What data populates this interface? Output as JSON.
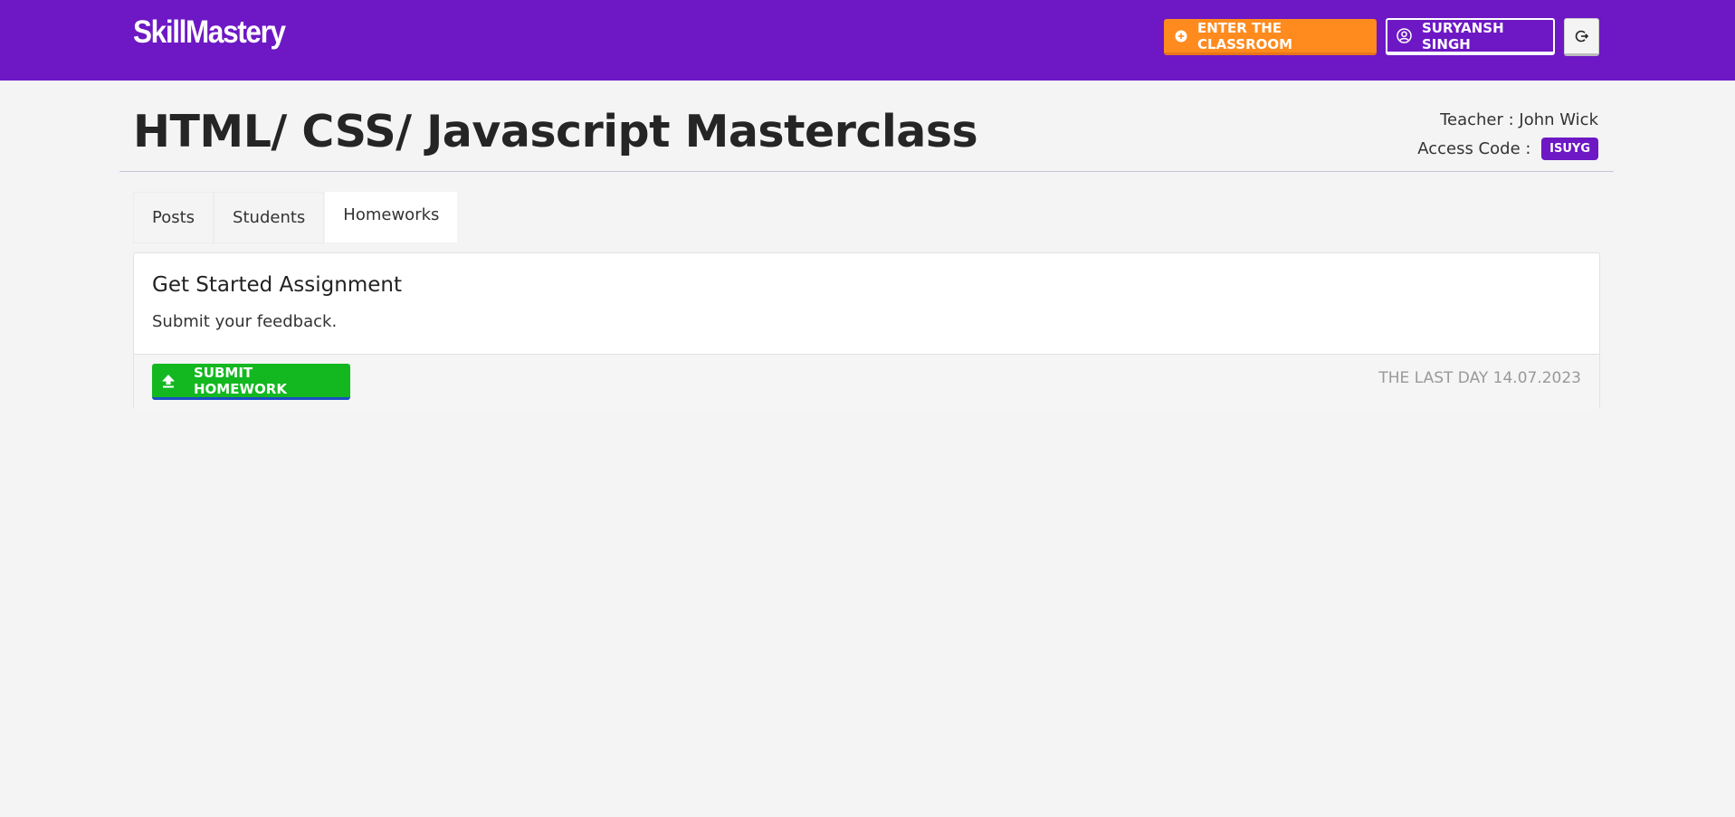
{
  "header": {
    "brand": "SkillMastery",
    "classroom_button": "ENTER THE CLASSROOM",
    "user_button": "SURYANSH SINGH",
    "logout_icon": "logout-icon",
    "colors": {
      "topbar": "#6d18c4",
      "classroom_button": "#ff8a1d"
    }
  },
  "course": {
    "title": "HTML/ CSS/ Javascript Masterclass",
    "teacher_label": "Teacher : ",
    "teacher_name": "John Wick",
    "access_label": "Access Code : ",
    "access_code": "ISUYG"
  },
  "tabs": [
    {
      "label": "Posts",
      "active": false
    },
    {
      "label": "Students",
      "active": false
    },
    {
      "label": "Homeworks",
      "active": true
    }
  ],
  "homework": {
    "title": "Get Started Assignment",
    "description": "Submit your feedback.",
    "submit_button": "SUBMIT HOMEWORK",
    "deadline": "THE LAST DAY 14.07.2023",
    "colors": {
      "submit_button": "#13b820"
    }
  }
}
